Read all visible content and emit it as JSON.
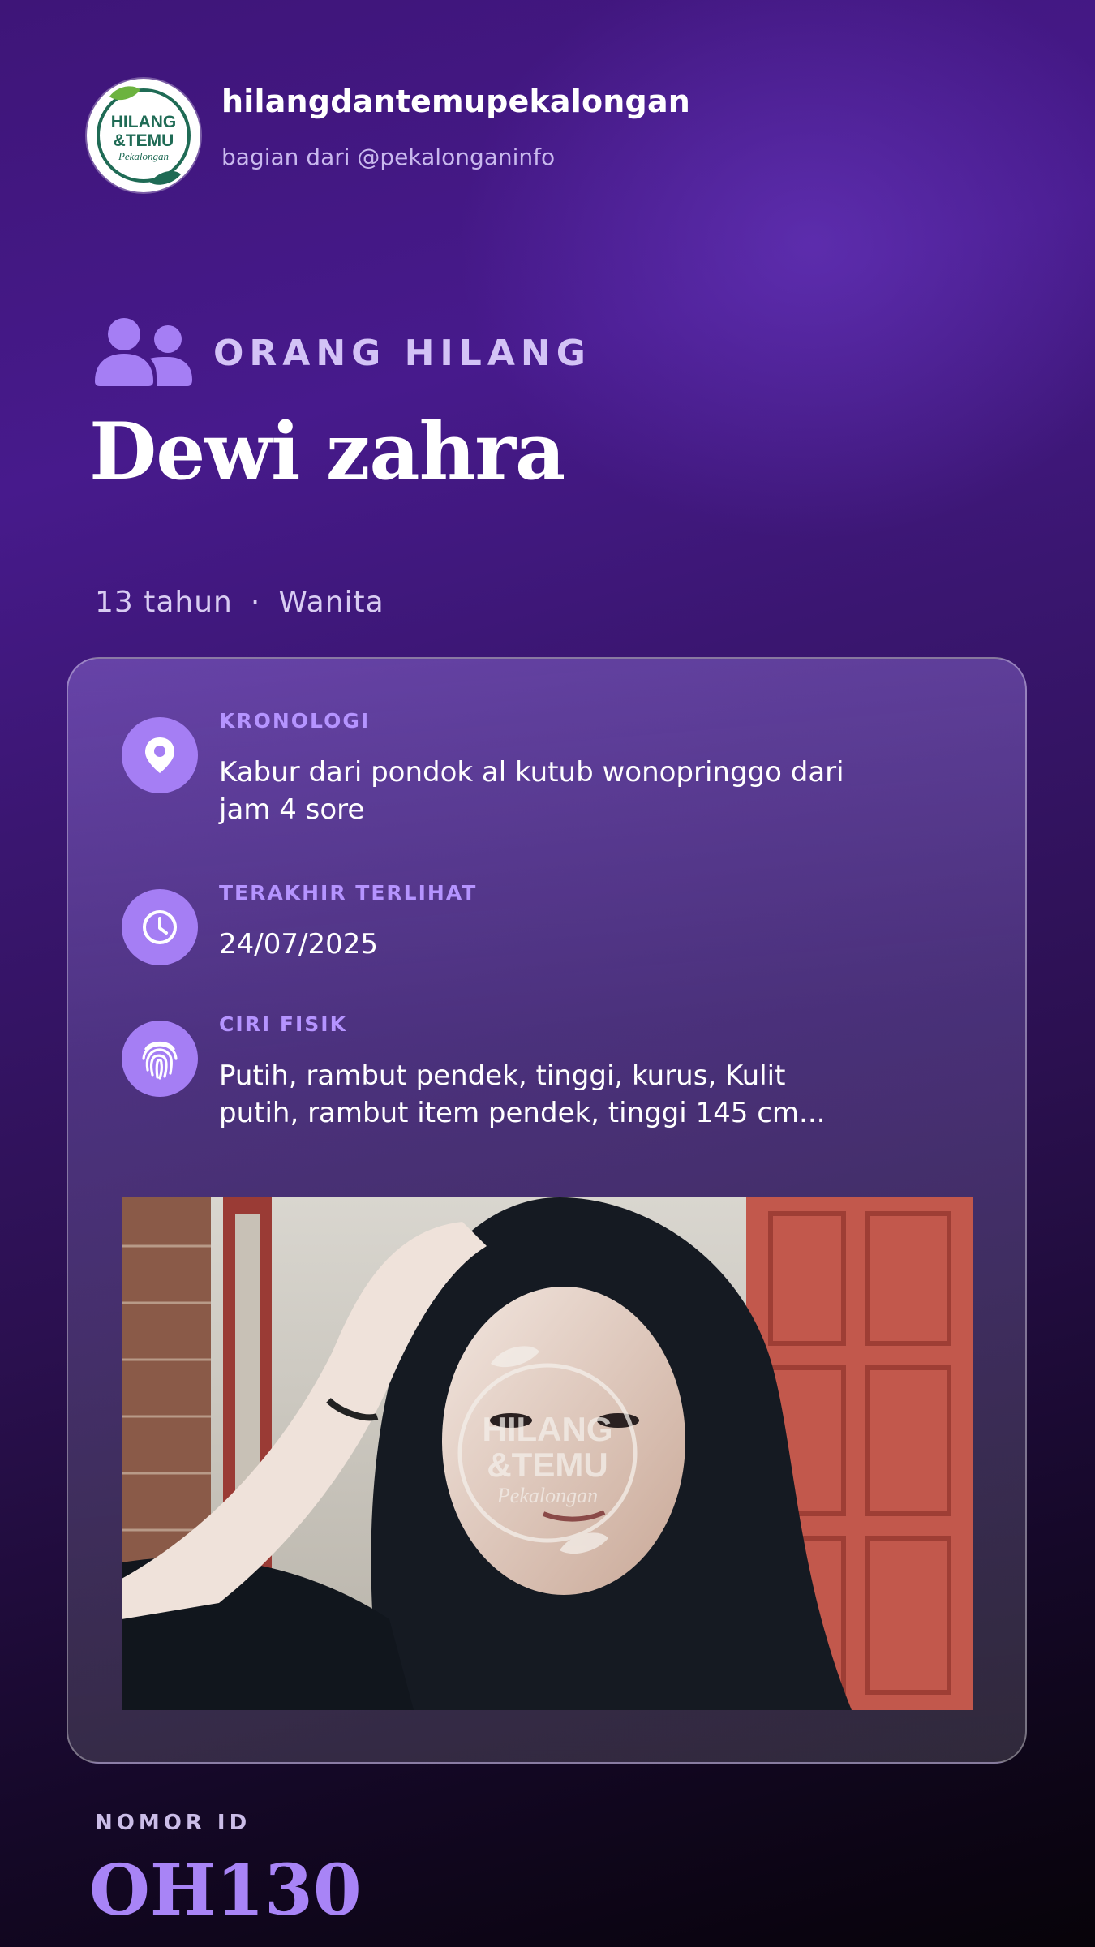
{
  "header": {
    "logo_text": "HILANG &TEMU Pekalongan",
    "account_name": "hilangdantemupekalongan",
    "subtitle": "bagian dari @pekalonganinfo"
  },
  "category": {
    "icon": "people-icon",
    "label": "ORANG HILANG"
  },
  "person": {
    "name": "Dewi zahra",
    "age": "13 tahun",
    "separator": "·",
    "gender": "Wanita"
  },
  "details": [
    {
      "icon": "location-pin-icon",
      "label": "KRONOLOGI",
      "value": "Kabur dari pondok al kutub wonopringgo dari jam 4 sore"
    },
    {
      "icon": "clock-icon",
      "label": "TERAKHIR TERLIHAT",
      "value": "24/07/2025"
    },
    {
      "icon": "fingerprint-icon",
      "label": "CIRI FISIK",
      "value": "Putih, rambut pendek, tinggi, kurus, Kulit putih, rambut item pendek, tinggi 145 cm..."
    }
  ],
  "photo": {
    "watermark_text": "HILANG &TEMU Pekalongan"
  },
  "id": {
    "label": "NOMOR ID",
    "value": "OH130"
  },
  "colors": {
    "accent": "#a57ef4",
    "label_purple": "#b594ff",
    "logo_green": "#1f6b55"
  }
}
